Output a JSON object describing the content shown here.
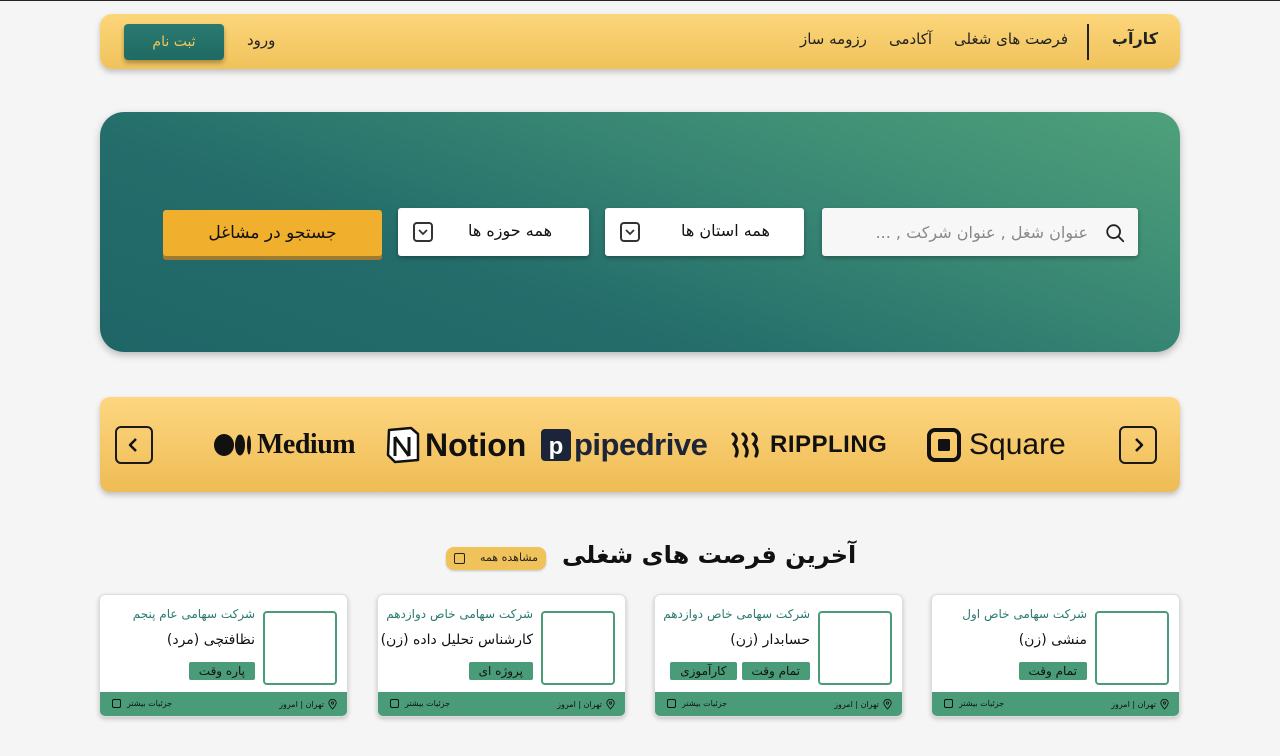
{
  "header": {
    "brand": "کارآب",
    "nav": [
      "فرصت های شغلی",
      "آکادمی",
      "رزومه ساز"
    ],
    "login_label": "ورود",
    "signup_label": "ثبت نام"
  },
  "hero": {
    "search_placeholder": "عنوان شغل , عنوان شرکت , ...",
    "province_select": "همه استان ها",
    "field_select": "همه حوزه ها",
    "search_button": "جستجو در مشاغل"
  },
  "logos": [
    "Square",
    "RIPPLING",
    "pipedrive",
    "Notion",
    "Medium"
  ],
  "jobs_section": {
    "title": "آخرین فرصت های شغلی",
    "view_all": "مشاهده همه"
  },
  "jobs": [
    {
      "company": "شرکت سهامی خاص اول",
      "title": "منشی (زن)",
      "tags": [
        "تمام وقت"
      ],
      "location": "تهران | امروز",
      "more": "جزئیات بیشتر"
    },
    {
      "company": "شرکت سهامی خاص دوازدهم",
      "title": "حسابدار (زن)",
      "tags": [
        "تمام وقت",
        "کارآموزی"
      ],
      "location": "تهران | امروز",
      "more": "جزئیات بیشتر"
    },
    {
      "company": "شرکت سهامی خاص دوازدهم",
      "title": "کارشناس تحلیل داده (زن)",
      "tags": [
        "پروژه ای"
      ],
      "location": "تهران | امروز",
      "more": "جزئیات بیشتر"
    },
    {
      "company": "شرکت سهامی عام پنجم",
      "title": "نظافتچی (مرد)",
      "tags": [
        "پاره وقت"
      ],
      "location": "تهران | امروز",
      "more": "جزئیات بیشتر"
    }
  ],
  "colors": {
    "accent_yellow": "#f0c25a",
    "primary_green": "#2a7a70",
    "card_green": "#4a9c78",
    "search_button": "#f0b02e"
  },
  "icons": [
    "search-icon",
    "chevron-down-icon",
    "chevron-left-icon",
    "chevron-right-icon",
    "location-pin-icon"
  ]
}
